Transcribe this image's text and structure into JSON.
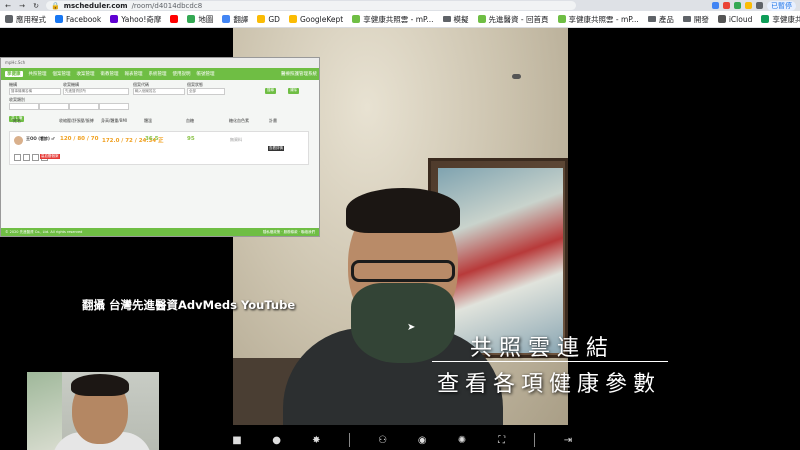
{
  "browser": {
    "url_domain": "mscheduler.com",
    "url_path": "/room/d4014dbcdc8",
    "profile_label": "已暫停"
  },
  "bookmarks": [
    {
      "label": "應用程式",
      "icon": "apps-grid-icon",
      "color": "#5f6368"
    },
    {
      "label": "Facebook",
      "icon": "facebook-icon",
      "color": "#1877f2"
    },
    {
      "label": "Yahoo!奇摩",
      "icon": "yahoo-icon",
      "color": "#6001d2"
    },
    {
      "label": "",
      "icon": "youtube-icon",
      "color": "#ff0000"
    },
    {
      "label": "地圖",
      "icon": "maps-icon",
      "color": "#34a853"
    },
    {
      "label": "翻譯",
      "icon": "translate-icon",
      "color": "#4285f4"
    },
    {
      "label": "GD",
      "icon": "drive-icon",
      "color": "#fbbc04"
    },
    {
      "label": "GoogleKept",
      "icon": "keep-icon",
      "color": "#fbbc04"
    },
    {
      "label": "享健康共照雲 - mP...",
      "icon": "mp-icon",
      "color": "#6fbe44"
    },
    {
      "label": "模擬",
      "icon": "folder-icon",
      "color": "#5f6368"
    },
    {
      "label": "先進醫資 - 回首頁",
      "icon": "advmeds-icon",
      "color": "#6fbe44"
    },
    {
      "label": "享健康共照雲 - mP...",
      "icon": "mp-icon",
      "color": "#6fbe44"
    },
    {
      "label": "產品",
      "icon": "folder-icon",
      "color": "#5f6368"
    },
    {
      "label": "開發",
      "icon": "folder-icon",
      "color": "#5f6368"
    },
    {
      "label": "iCloud",
      "icon": "apple-icon",
      "color": "#555555"
    },
    {
      "label": "享健康共照雲帳號...",
      "icon": "sheet-icon",
      "color": "#0f9d58"
    }
  ],
  "share": {
    "tab_label": "mpHc.Sch",
    "brand": "享健康",
    "nav_items": [
      "共照管理",
      "個案管理",
      "收案管理",
      "衛教管理",
      "報表管理",
      "系統管理",
      "使用說明",
      "帳號管理"
    ],
    "nav_right": "醫療照護管理系統",
    "form": {
      "f1_label": "機構",
      "f1_value": "醫事機構名稱",
      "f2_label": "收案機構",
      "f2_value": "先進醫資診所",
      "f3_label": "個案代碼",
      "f3_value": "輸入個案姓名",
      "f4_label": "個案狀態",
      "f4_value": "全部",
      "f5_label": "收案類別",
      "btn_search": "搜尋",
      "btn_reset": "清除",
      "btn_add": "新增個案",
      "btn_export": "匯出",
      "pill": "共 1 筆"
    },
    "table_headers": [
      "姓名",
      "收縮壓/舒張壓/脈搏",
      "身高/體重/BMI",
      "體溫",
      "血糖",
      "糖化血色素",
      "計畫"
    ],
    "row": {
      "name": "王OO (看診) ♂",
      "bp": "120 / 80 / 70",
      "hw": "172.0 / 72 / 24.34 正",
      "temp": "36.5",
      "sugar": "95",
      "hba1c": "無資料",
      "plan": "",
      "tag": "高血壓個案",
      "badge": "查看詳情"
    },
    "footer_left": "© 2020 先進醫資 Co., Ltd. All rights reserved",
    "footer_right": "隱私權政策 · 服務條款 · 聯絡我們"
  },
  "captions": {
    "source": "翻攝 台灣先進醫資AdvMeds YouTube",
    "line1": "共照雲連結",
    "line2": "查看各項健康參數"
  },
  "toolbar": [
    {
      "name": "camera-button",
      "icon": "camera-icon",
      "glyph": "■"
    },
    {
      "name": "mic-button",
      "icon": "mic-icon",
      "glyph": "●"
    },
    {
      "name": "settings-button",
      "icon": "gear-icon",
      "glyph": "✸"
    },
    {
      "name": "participants-button",
      "icon": "people-icon",
      "glyph": "⚇"
    },
    {
      "name": "record-button",
      "icon": "record-icon",
      "glyph": "◉"
    },
    {
      "name": "effects-button",
      "icon": "aperture-icon",
      "glyph": "✺"
    },
    {
      "name": "fullscreen-button",
      "icon": "fullscreen-icon",
      "glyph": "⛶"
    },
    {
      "name": "leave-button",
      "icon": "exit-icon",
      "glyph": "⇥"
    }
  ]
}
